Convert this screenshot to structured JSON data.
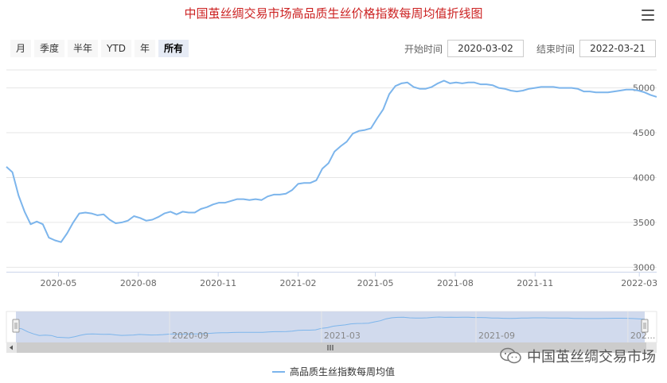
{
  "title": "中国茧丝绸交易市场高品质生丝价格指数每周均值折线图",
  "range_buttons": [
    "月",
    "季度",
    "半年",
    "YTD",
    "年",
    "所有"
  ],
  "range_active_index": 5,
  "date_range": {
    "start_label": "开始时间",
    "start_value": "2020-03-02",
    "end_label": "结束时间",
    "end_value": "2022-03-21"
  },
  "navigator": {
    "labels": [
      "2020-09",
      "2021-03",
      "2021-09",
      "202..."
    ]
  },
  "legend": {
    "series_name": "高品质生丝指数每周均值"
  },
  "watermark": {
    "text": "中国茧丝绸交易市场"
  },
  "colors": {
    "series": "#7cb5ec",
    "title": "#cc2222",
    "navigator_mask": "#ccd6eb"
  },
  "chart_data": {
    "type": "line",
    "title": "中国茧丝绸交易市场高品质生丝价格指数每周均值折线图",
    "xlabel": "",
    "ylabel": "",
    "x_ticks": [
      "2020-05",
      "2020-08",
      "2020-11",
      "2021-02",
      "2021-05",
      "2021-08",
      "2021-11",
      "2022-03"
    ],
    "y_ticks": [
      3000,
      3500,
      4000,
      4500,
      5000
    ],
    "ylim": [
      2950,
      5200
    ],
    "xlim": [
      "2020-03-02",
      "2022-03-21"
    ],
    "grid": true,
    "legend_position": "bottom-center",
    "series": [
      {
        "name": "高品质生丝指数每周均值",
        "x": [
          "2020-03-02",
          "2020-03-09",
          "2020-03-16",
          "2020-03-23",
          "2020-03-30",
          "2020-04-06",
          "2020-04-13",
          "2020-04-20",
          "2020-04-27",
          "2020-05-04",
          "2020-05-11",
          "2020-05-18",
          "2020-05-25",
          "2020-06-01",
          "2020-06-08",
          "2020-06-15",
          "2020-06-22",
          "2020-06-29",
          "2020-07-06",
          "2020-07-13",
          "2020-07-20",
          "2020-07-27",
          "2020-08-03",
          "2020-08-10",
          "2020-08-17",
          "2020-08-24",
          "2020-08-31",
          "2020-09-07",
          "2020-09-14",
          "2020-09-21",
          "2020-09-28",
          "2020-10-05",
          "2020-10-12",
          "2020-10-19",
          "2020-10-26",
          "2020-11-02",
          "2020-11-09",
          "2020-11-16",
          "2020-11-23",
          "2020-11-30",
          "2020-12-07",
          "2020-12-14",
          "2020-12-21",
          "2020-12-28",
          "2021-01-04",
          "2021-01-11",
          "2021-01-18",
          "2021-01-25",
          "2021-02-01",
          "2021-02-08",
          "2021-02-15",
          "2021-02-22",
          "2021-03-01",
          "2021-03-08",
          "2021-03-15",
          "2021-03-22",
          "2021-03-29",
          "2021-04-05",
          "2021-04-12",
          "2021-04-19",
          "2021-04-26",
          "2021-05-03",
          "2021-05-10",
          "2021-05-17",
          "2021-05-24",
          "2021-05-31",
          "2021-06-07",
          "2021-06-14",
          "2021-06-21",
          "2021-06-28",
          "2021-07-05",
          "2021-07-12",
          "2021-07-19",
          "2021-07-26",
          "2021-08-02",
          "2021-08-09",
          "2021-08-16",
          "2021-08-23",
          "2021-08-30",
          "2021-09-06",
          "2021-09-13",
          "2021-09-20",
          "2021-09-27",
          "2021-10-04",
          "2021-10-11",
          "2021-10-18",
          "2021-10-25",
          "2021-11-01",
          "2021-11-08",
          "2021-11-15",
          "2021-11-22",
          "2021-11-29",
          "2021-12-06",
          "2021-12-13",
          "2021-12-20",
          "2021-12-27",
          "2022-01-03",
          "2022-01-10",
          "2022-01-17",
          "2022-01-24",
          "2022-01-31",
          "2022-02-07",
          "2022-02-14",
          "2022-02-21",
          "2022-02-28",
          "2022-03-07",
          "2022-03-14",
          "2022-03-21"
        ],
        "values": [
          4120,
          4060,
          3800,
          3620,
          3480,
          3510,
          3480,
          3330,
          3300,
          3280,
          3380,
          3500,
          3600,
          3610,
          3600,
          3580,
          3590,
          3530,
          3490,
          3500,
          3520,
          3570,
          3550,
          3520,
          3530,
          3560,
          3600,
          3620,
          3590,
          3620,
          3610,
          3610,
          3650,
          3670,
          3700,
          3720,
          3720,
          3740,
          3760,
          3760,
          3750,
          3760,
          3750,
          3790,
          3810,
          3810,
          3820,
          3860,
          3930,
          3940,
          3940,
          3970,
          4100,
          4160,
          4290,
          4350,
          4400,
          4490,
          4520,
          4530,
          4550,
          4660,
          4760,
          4930,
          5020,
          5050,
          5060,
          5010,
          4990,
          4990,
          5010,
          5050,
          5080,
          5050,
          5060,
          5050,
          5060,
          5060,
          5040,
          5040,
          5030,
          5000,
          4990,
          4970,
          4960,
          4970,
          4990,
          5000,
          5010,
          5010,
          5010,
          5000,
          5000,
          5000,
          4990,
          4960,
          4960,
          4950,
          4950,
          4950,
          4960,
          4970,
          4980,
          4980,
          4970,
          4950,
          4920,
          4900
        ]
      }
    ]
  }
}
